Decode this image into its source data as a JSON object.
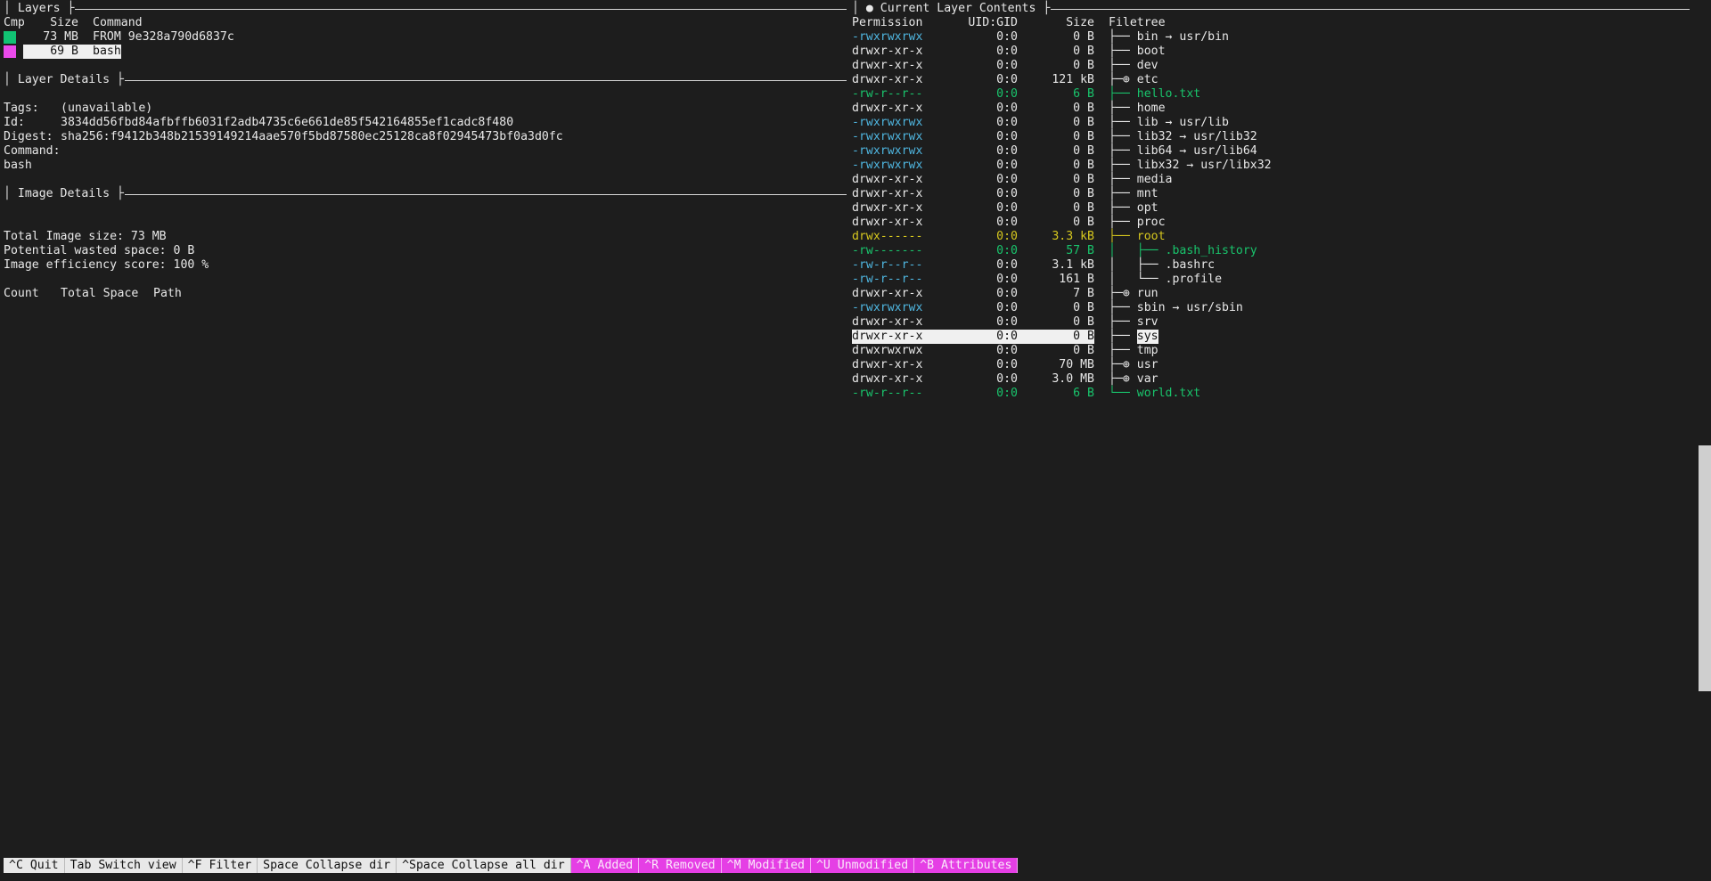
{
  "layers": {
    "title": "Layers",
    "columns": {
      "cmp": "Cmp",
      "size": "Size",
      "command": "Command"
    },
    "rows": [
      {
        "color": "#11c273",
        "size": "73 MB",
        "command": "FROM 9e328a790d6837c"
      },
      {
        "color": "#ea4aea",
        "size": "69 B",
        "command": "bash"
      }
    ]
  },
  "layer_details": {
    "title": "Layer Details",
    "tags_label": "Tags:",
    "tags": "(unavailable)",
    "id_label": "Id:",
    "id": "3834dd56fbd84afbffb6031f2adb4735c6e661de85f542164855ef1cadc8f480",
    "digest_label": "Digest:",
    "digest": "sha256:f9412b348b21539149214aae570f5bd87580ec25128ca8f02945473bf0a3d0fc",
    "command_label": "Command:",
    "command": "bash"
  },
  "image_details": {
    "title": "Image Details",
    "total_size": "Total Image size: 73 MB",
    "wasted": "Potential wasted space: 0 B",
    "efficiency": "Image efficiency score: 100 %",
    "columns": {
      "count": "Count",
      "total": "Total Space",
      "path": "Path"
    }
  },
  "contents": {
    "title": "● Current Layer Contents",
    "columns": {
      "perm": "Permission",
      "uid": "UID:GID",
      "size": "Size",
      "tree": "Filetree"
    },
    "rows": [
      {
        "perm": "-rwxrwxrwx",
        "uid": "0:0",
        "size": "0 B",
        "tree": "├── bin → usr/bin",
        "style": "cyan-perm"
      },
      {
        "perm": "drwxr-xr-x",
        "uid": "0:0",
        "size": "0 B",
        "tree": "├── boot",
        "style": ""
      },
      {
        "perm": "drwxr-xr-x",
        "uid": "0:0",
        "size": "0 B",
        "tree": "├── dev",
        "style": ""
      },
      {
        "perm": "drwxr-xr-x",
        "uid": "0:0",
        "size": "121 kB",
        "tree": "├─⊕ etc",
        "style": ""
      },
      {
        "perm": "-rw-r--r--",
        "uid": "0:0",
        "size": "6 B",
        "tree": "├── hello.txt",
        "style": "green"
      },
      {
        "perm": "drwxr-xr-x",
        "uid": "0:0",
        "size": "0 B",
        "tree": "├── home",
        "style": ""
      },
      {
        "perm": "-rwxrwxrwx",
        "uid": "0:0",
        "size": "0 B",
        "tree": "├── lib → usr/lib",
        "style": "cyan-perm"
      },
      {
        "perm": "-rwxrwxrwx",
        "uid": "0:0",
        "size": "0 B",
        "tree": "├── lib32 → usr/lib32",
        "style": "cyan-perm"
      },
      {
        "perm": "-rwxrwxrwx",
        "uid": "0:0",
        "size": "0 B",
        "tree": "├── lib64 → usr/lib64",
        "style": "cyan-perm"
      },
      {
        "perm": "-rwxrwxrwx",
        "uid": "0:0",
        "size": "0 B",
        "tree": "├── libx32 → usr/libx32",
        "style": "cyan-perm"
      },
      {
        "perm": "drwxr-xr-x",
        "uid": "0:0",
        "size": "0 B",
        "tree": "├── media",
        "style": ""
      },
      {
        "perm": "drwxr-xr-x",
        "uid": "0:0",
        "size": "0 B",
        "tree": "├── mnt",
        "style": ""
      },
      {
        "perm": "drwxr-xr-x",
        "uid": "0:0",
        "size": "0 B",
        "tree": "├── opt",
        "style": ""
      },
      {
        "perm": "drwxr-xr-x",
        "uid": "0:0",
        "size": "0 B",
        "tree": "├── proc",
        "style": ""
      },
      {
        "perm": "drwx------",
        "uid": "0:0",
        "size": "3.3 kB",
        "tree": "├── root",
        "style": "yellow"
      },
      {
        "perm": "-rw-------",
        "uid": "0:0",
        "size": "57 B",
        "tree": "│   ├── .bash_history",
        "style": "green"
      },
      {
        "perm": "-rw-r--r--",
        "uid": "0:0",
        "size": "3.1 kB",
        "tree": "│   ├── .bashrc",
        "style": "cyan-perm"
      },
      {
        "perm": "-rw-r--r--",
        "uid": "0:0",
        "size": "161 B",
        "tree": "│   └── .profile",
        "style": "cyan-perm"
      },
      {
        "perm": "drwxr-xr-x",
        "uid": "0:0",
        "size": "7 B",
        "tree": "├─⊕ run",
        "style": ""
      },
      {
        "perm": "-rwxrwxrwx",
        "uid": "0:0",
        "size": "0 B",
        "tree": "├── sbin → usr/sbin",
        "style": "cyan-perm"
      },
      {
        "perm": "drwxr-xr-x",
        "uid": "0:0",
        "size": "0 B",
        "tree": "├── srv",
        "style": ""
      },
      {
        "perm": "drwxr-xr-x",
        "uid": "0:0",
        "size": "0 B",
        "tree": "├── sys",
        "style": "selected"
      },
      {
        "perm": "drwxrwxrwx",
        "uid": "0:0",
        "size": "0 B",
        "tree": "├── tmp",
        "style": ""
      },
      {
        "perm": "drwxr-xr-x",
        "uid": "0:0",
        "size": "70 MB",
        "tree": "├─⊕ usr",
        "style": ""
      },
      {
        "perm": "drwxr-xr-x",
        "uid": "0:0",
        "size": "3.0 MB",
        "tree": "├─⊕ var",
        "style": ""
      },
      {
        "perm": "-rw-r--r--",
        "uid": "0:0",
        "size": "6 B",
        "tree": "└── world.txt",
        "style": "green"
      }
    ]
  },
  "status_bar": [
    {
      "label": "^C Quit",
      "kind": "k"
    },
    {
      "label": "Tab Switch view",
      "kind": "k"
    },
    {
      "label": "^F Filter",
      "kind": "k"
    },
    {
      "label": "Space Collapse dir",
      "kind": "k"
    },
    {
      "label": "^Space Collapse all dir",
      "kind": "k"
    },
    {
      "label": "^A Added",
      "kind": "m"
    },
    {
      "label": "^R Removed",
      "kind": "m"
    },
    {
      "label": "^M Modified",
      "kind": "m"
    },
    {
      "label": "^U Unmodified",
      "kind": "m"
    },
    {
      "label": "^B Attributes",
      "kind": "m"
    }
  ],
  "colors": {
    "cyan": "#4fb6e0",
    "green": "#19c46c",
    "yellow": "#d7c81e",
    "magenta": "#e53fe5"
  }
}
